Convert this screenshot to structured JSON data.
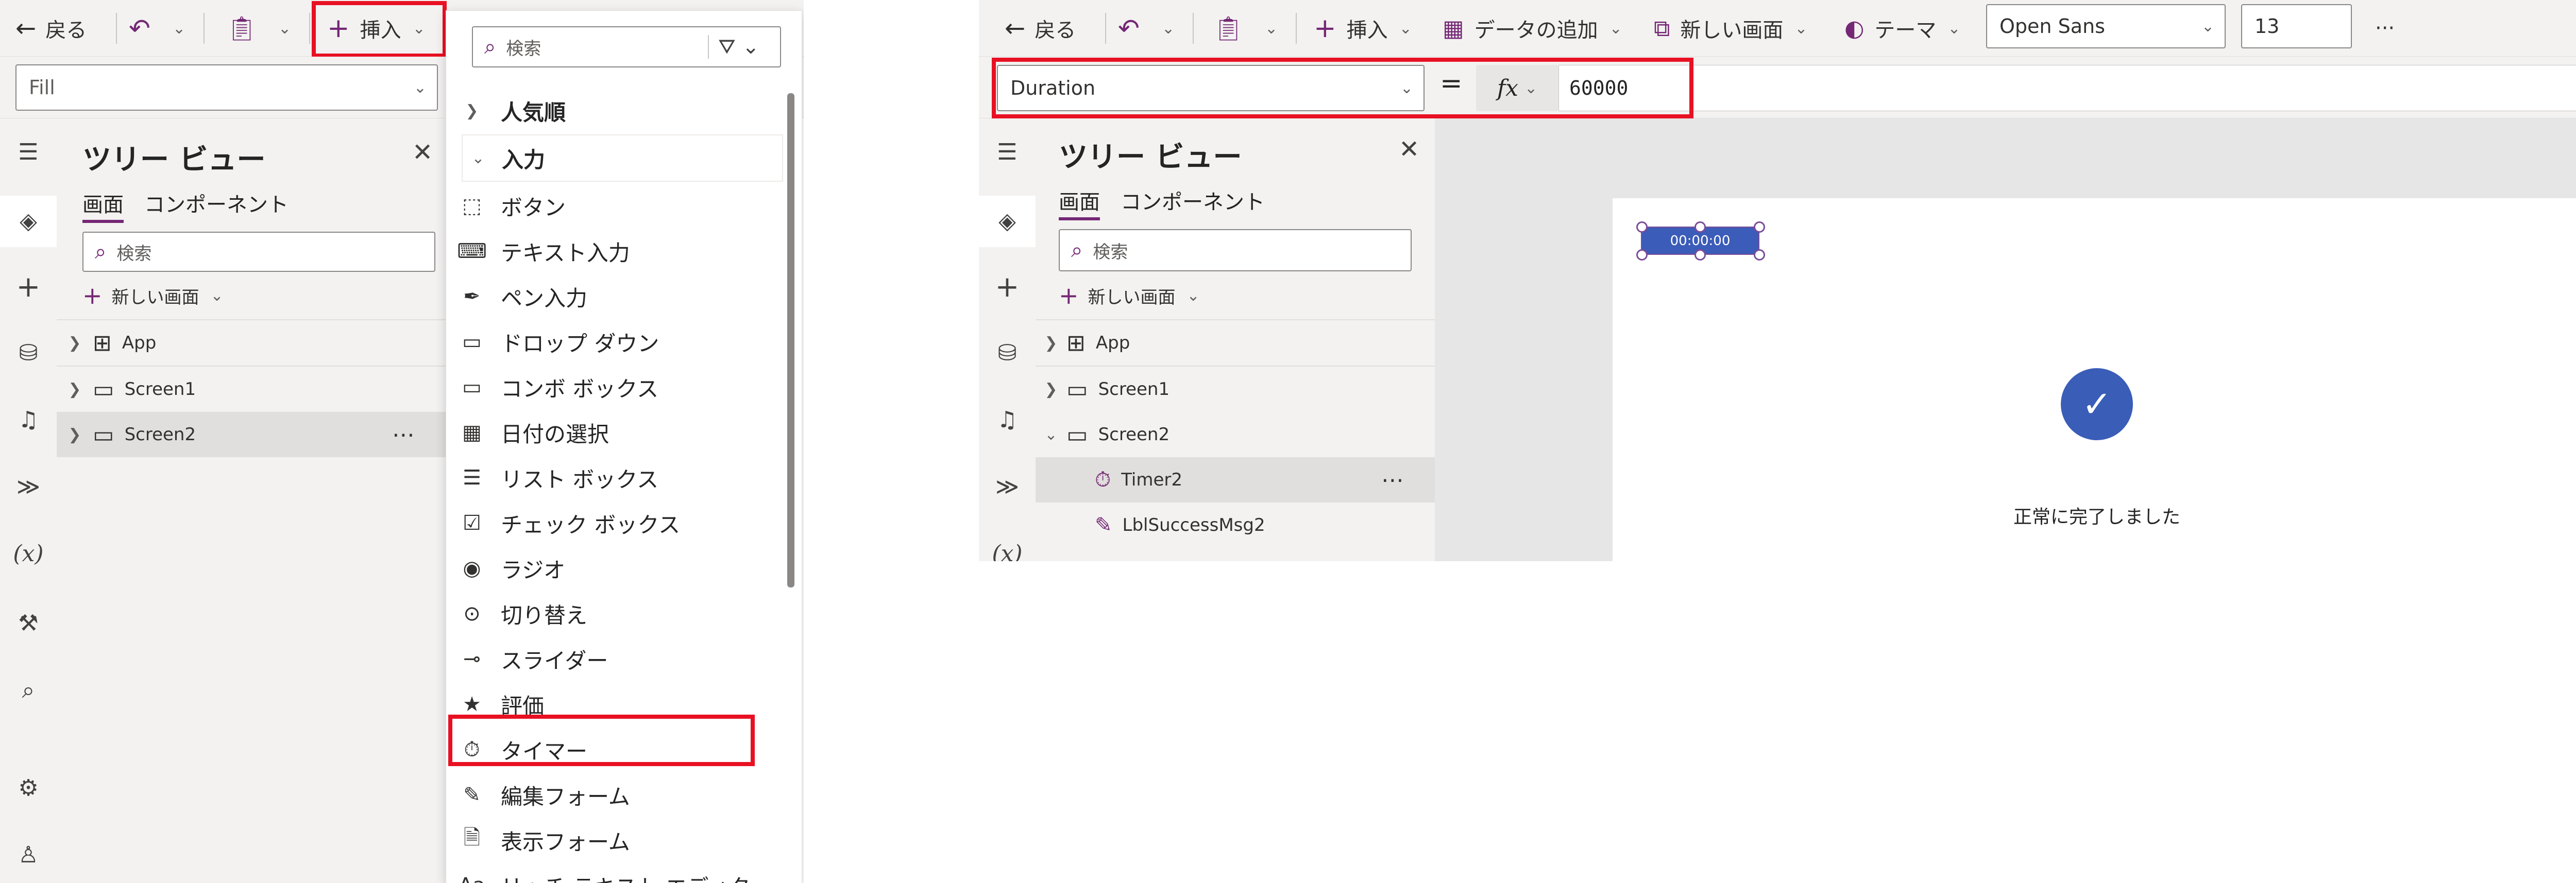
{
  "left": {
    "toolbar": {
      "back_label": "戻る",
      "insert_label": "挿入"
    },
    "property": {
      "value": "Fill"
    },
    "tree": {
      "title": "ツリー ビュー",
      "tabs": [
        "画面",
        "コンポーネント"
      ],
      "search_placeholder": "検索",
      "new_screen_label": "新しい画面",
      "items": [
        {
          "label": "App",
          "icon": "app-icon"
        },
        {
          "label": "Screen1",
          "icon": "screen-icon"
        },
        {
          "label": "Screen2",
          "icon": "screen-icon",
          "selected": true
        }
      ],
      "more_label": "⋯"
    },
    "insert_menu": {
      "search_placeholder": "検索",
      "groups": [
        {
          "label": "人気順",
          "expanded": false
        },
        {
          "label": "入力",
          "expanded": true
        }
      ],
      "items": [
        {
          "label": "ボタン",
          "icon": "button-icon"
        },
        {
          "label": "テキスト入力",
          "icon": "text-input-icon"
        },
        {
          "label": "ペン入力",
          "icon": "pen-icon"
        },
        {
          "label": "ドロップ ダウン",
          "icon": "dropdown-icon"
        },
        {
          "label": "コンボ ボックス",
          "icon": "combo-icon"
        },
        {
          "label": "日付の選択",
          "icon": "calendar-icon"
        },
        {
          "label": "リスト ボックス",
          "icon": "listbox-icon"
        },
        {
          "label": "チェック ボックス",
          "icon": "checkbox-icon"
        },
        {
          "label": "ラジオ",
          "icon": "radio-icon"
        },
        {
          "label": "切り替え",
          "icon": "toggle-icon"
        },
        {
          "label": "スライダー",
          "icon": "slider-icon"
        },
        {
          "label": "評価",
          "icon": "rating-icon"
        },
        {
          "label": "タイマー",
          "icon": "timer-icon",
          "highlighted": true
        },
        {
          "label": "編集フォーム",
          "icon": "edit-form-icon"
        },
        {
          "label": "表示フォーム",
          "icon": "display-form-icon"
        },
        {
          "label": "リッチ テキスト エディタ",
          "icon": "rich-text-icon"
        }
      ]
    }
  },
  "right": {
    "toolbar": {
      "back_label": "戻る",
      "insert_label": "挿入",
      "add_data_label": "データの追加",
      "new_screen_label": "新しい画面",
      "theme_label": "テーマ",
      "font_value": "Open Sans",
      "font_size_value": "13",
      "more_label": "···"
    },
    "formula": {
      "property": "Duration",
      "equals": "=",
      "fx": "fx",
      "value": "60000"
    },
    "tree": {
      "title": "ツリー ビュー",
      "tabs": [
        "画面",
        "コンポーネント"
      ],
      "search_placeholder": "検索",
      "new_screen_label": "新しい画面",
      "items": [
        {
          "label": "App",
          "icon": "app-icon"
        },
        {
          "label": "Screen1",
          "icon": "screen-icon"
        },
        {
          "label": "Screen2",
          "icon": "screen-icon"
        },
        {
          "label": "Timer2",
          "icon": "timer-icon",
          "selected": true
        },
        {
          "label": "LblSuccessMsg2",
          "icon": "label-icon"
        }
      ],
      "more_label": "⋯"
    },
    "canvas": {
      "timer_text": "00:00:00",
      "success_message": "正常に完了しました"
    }
  },
  "colors": {
    "accent": "#742774",
    "highlight_red": "#e81123",
    "timer_blue": "#3b5cb8",
    "check_blue": "#3a5db8"
  }
}
